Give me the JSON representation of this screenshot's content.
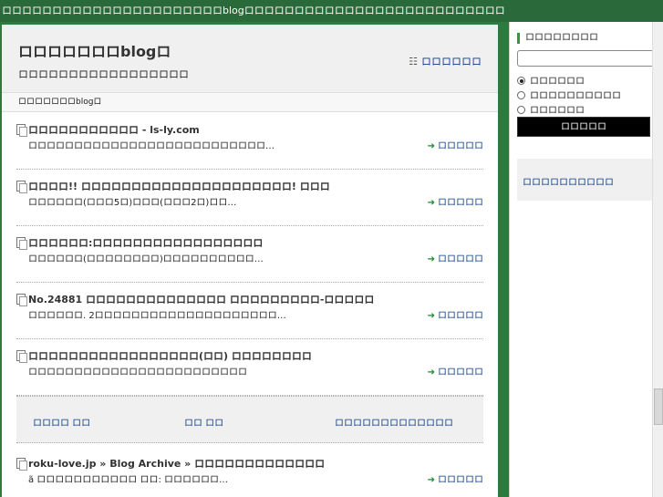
{
  "topbar": {
    "text": "ロロロロロロロロロロロロロロロロロロロロロロblogロロロロロロロロロロロロロロロロロロロロロロロロロロ"
  },
  "header": {
    "site_title": "ロロロロロロロblogロ",
    "site_desc": "ロロロロロロロロロロロロロロロロロ",
    "sitemap_icon": "sitemap-icon",
    "sitemap_label": "ロロロロロロ"
  },
  "breadcrumb": "ロロロロロロロblogロ",
  "posts": [
    {
      "title": "ロロロロロロロロロロロ - ls-ly.com",
      "excerpt": "ロロロロロロロロロロロロロロロロロロロロロロロロロロ…",
      "more": "ロロロロロ"
    },
    {
      "title": "ロロロロ!! ロロロロロロロロロロロロロロロロロロロロロ! ロロロ",
      "excerpt": "ロロロロロロ(ロロロ5ロ)ロロロ(ロロロ2ロ)ロロ…",
      "more": "ロロロロロ"
    },
    {
      "title": "ロロロロロロ:ロロロロロロロロロロロロロロロロロ",
      "excerpt": "ロロロロロロ(ロロロロロロロロ)ロロロロロロロロロロ…",
      "more": "ロロロロロ"
    },
    {
      "title": "No.24881 ロロロロロロロロロロロロロロ ロロロロロロロロロ-ロロロロロ",
      "excerpt": "ロロロロロロ. 2ロロロロロロロロロロロロロロロロロロロロ…",
      "more": "ロロロロロ"
    },
    {
      "title": "ロロロロロロロロロロロロロロロロロ(ロロ) ロロロロロロロロ",
      "excerpt": "ロロロロロロロロロロロロロロロロロロロロロロロロ",
      "more": "ロロロロロ"
    },
    {
      "title": "roku-love.jp » Blog Archive » ロロロロロロロロロロロロロ",
      "excerpt": "ã ロロロロロロロロロロロ ロロ: ロロロロロロ…",
      "more": "ロロロロロ"
    }
  ],
  "linkbox": {
    "prev": "ロロロロ ロロ",
    "mid": "ロロ ロロ",
    "next": "ロロロロロロロロロロロロロ"
  },
  "sidebar": {
    "search_heading": "ロロロロロロロロ",
    "search_value": "",
    "options": [
      {
        "label": "ロロロロロロ",
        "checked": true
      },
      {
        "label": "ロロロロロロロロロロ",
        "checked": false
      },
      {
        "label": "ロロロロロロ",
        "checked": false
      }
    ],
    "search_button": "ロロロロロ",
    "box_link": "ロロロロロロロロロロ"
  },
  "colors": {
    "topbar": "#2a6a3a",
    "frame": "#2d7a3e",
    "accent_arrow": "#1a8a2a",
    "link": "#0b3a86"
  }
}
